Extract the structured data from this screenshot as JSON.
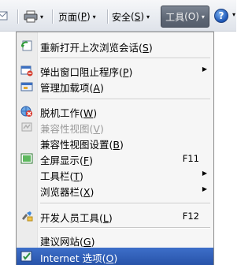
{
  "toolbar": {
    "print_arrow": "▾",
    "page_label": "页面",
    "page_key": "P",
    "safety_label": "安全",
    "safety_key": "S",
    "tools_label": "工具",
    "tools_key": "O",
    "help_glyph": "?"
  },
  "menu": {
    "items": [
      {
        "label": "重新打开上次浏览会话",
        "key": "S",
        "icon": "reopen-session-icon"
      },
      {
        "label": "弹出窗口阻止程序",
        "key": "P",
        "icon": "popup-blocker-icon",
        "submenu": true
      },
      {
        "label": "管理加载项",
        "key": "A",
        "icon": "manage-addons-icon"
      },
      {
        "label": "脱机工作",
        "key": "W",
        "icon": "work-offline-icon"
      },
      {
        "label": "兼容性视图",
        "key": "V",
        "icon": "compat-view-icon",
        "disabled": true
      },
      {
        "label": "兼容性视图设置",
        "key": "B"
      },
      {
        "label": "全屏显示",
        "key": "F",
        "icon": "fullscreen-icon",
        "shortcut": "F11"
      },
      {
        "label": "工具栏",
        "key": "T",
        "submenu": true
      },
      {
        "label": "浏览器栏",
        "key": "X",
        "submenu": true
      },
      {
        "label": "开发人员工具",
        "key": "L",
        "icon": "developer-tools-icon",
        "shortcut": "F12"
      },
      {
        "label": "建议网站",
        "key": "G"
      },
      {
        "label": "Internet 选项",
        "key": "O",
        "icon": "internet-options-icon",
        "highlighted": true
      }
    ]
  },
  "colors": {
    "highlight": "#2f5db5",
    "tools_button": "#5d6674",
    "menu_bg": "#f6f6f6"
  }
}
